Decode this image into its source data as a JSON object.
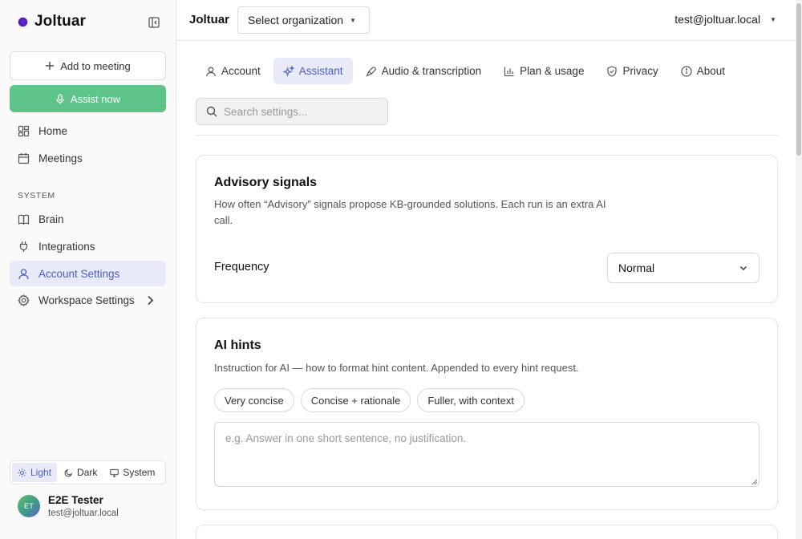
{
  "sidebar": {
    "brand": "Joltuar",
    "add_to_meeting": "Add to meeting",
    "assist_now": "Assist now",
    "nav": [
      {
        "label": "Home"
      },
      {
        "label": "Meetings"
      }
    ],
    "section_system": "SYSTEM",
    "system_nav": [
      {
        "label": "Brain"
      },
      {
        "label": "Integrations"
      },
      {
        "label": "Account Settings"
      },
      {
        "label": "Workspace Settings"
      }
    ],
    "theme": {
      "light": "Light",
      "dark": "Dark",
      "system": "System",
      "selected": "Light"
    },
    "user": {
      "initials": "ET",
      "name": "E2E Tester",
      "email": "test@joltuar.local"
    }
  },
  "topbar": {
    "brand": "Joltuar",
    "org_select": "Select organization",
    "user_email": "test@joltuar.local"
  },
  "tabs": [
    {
      "label": "Account"
    },
    {
      "label": "Assistant"
    },
    {
      "label": "Audio & transcription"
    },
    {
      "label": "Plan & usage"
    },
    {
      "label": "Privacy"
    },
    {
      "label": "About"
    }
  ],
  "active_tab": "Assistant",
  "search": {
    "placeholder": "Search settings..."
  },
  "advisory": {
    "title": "Advisory signals",
    "description": "How often “Advisory” signals propose KB-grounded solutions. Each run is an extra AI call.",
    "frequency_label": "Frequency",
    "frequency_value": "Normal"
  },
  "ai_hints": {
    "title": "AI hints",
    "description": "Instruction for AI — how to format hint content. Appended to every hint request.",
    "chips": [
      "Very concise",
      "Concise + rationale",
      "Fuller, with context"
    ],
    "textarea_placeholder": "e.g. Answer in one short sentence, no justification.",
    "textarea_value": ""
  }
}
